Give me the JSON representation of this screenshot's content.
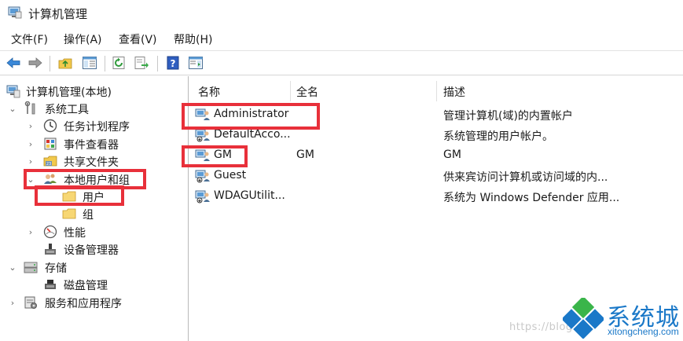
{
  "window": {
    "title": "计算机管理"
  },
  "menu": [
    "文件(F)",
    "操作(A)",
    "查看(V)",
    "帮助(H)"
  ],
  "toolbar": {
    "icons": [
      "back-arrow-icon",
      "forward-arrow-icon",
      "up-folder-icon",
      "show-hide-tree-icon",
      "refresh-icon",
      "export-list-icon",
      "help-icon",
      "show-hide-action-pane-icon"
    ]
  },
  "tree": {
    "root": "计算机管理(本地)",
    "system_tools": "系统工具",
    "task_scheduler": "任务计划程序",
    "event_viewer": "事件查看器",
    "shared_folders": "共享文件夹",
    "local_users_groups": "本地用户和组",
    "users": "用户",
    "groups": "组",
    "performance": "性能",
    "device_manager": "设备管理器",
    "storage": "存储",
    "disk_management": "磁盘管理",
    "services_apps": "服务和应用程序"
  },
  "list": {
    "columns": [
      "名称",
      "全名",
      "描述"
    ],
    "rows": [
      {
        "name": "Administrator",
        "full_name": "",
        "description": "管理计算机(域)的内置帐户"
      },
      {
        "name": "DefaultAcco...",
        "full_name": "",
        "description": "系统管理的用户帐户。"
      },
      {
        "name": "GM",
        "full_name": "GM",
        "description": "GM"
      },
      {
        "name": "Guest",
        "full_name": "",
        "description": "供来宾访问计算机或访问域的内..."
      },
      {
        "name": "WDAGUtilit...",
        "full_name": "",
        "description": "系统为 Windows Defender 应用..."
      }
    ]
  },
  "watermark": {
    "blog_text": "https://blog",
    "brand_name": "系统城",
    "brand_url": "xitongcheng.com"
  },
  "colors": {
    "highlight": "#e8303a",
    "brand_blue": "#1a78c8",
    "brand_green": "#3ab54a"
  }
}
